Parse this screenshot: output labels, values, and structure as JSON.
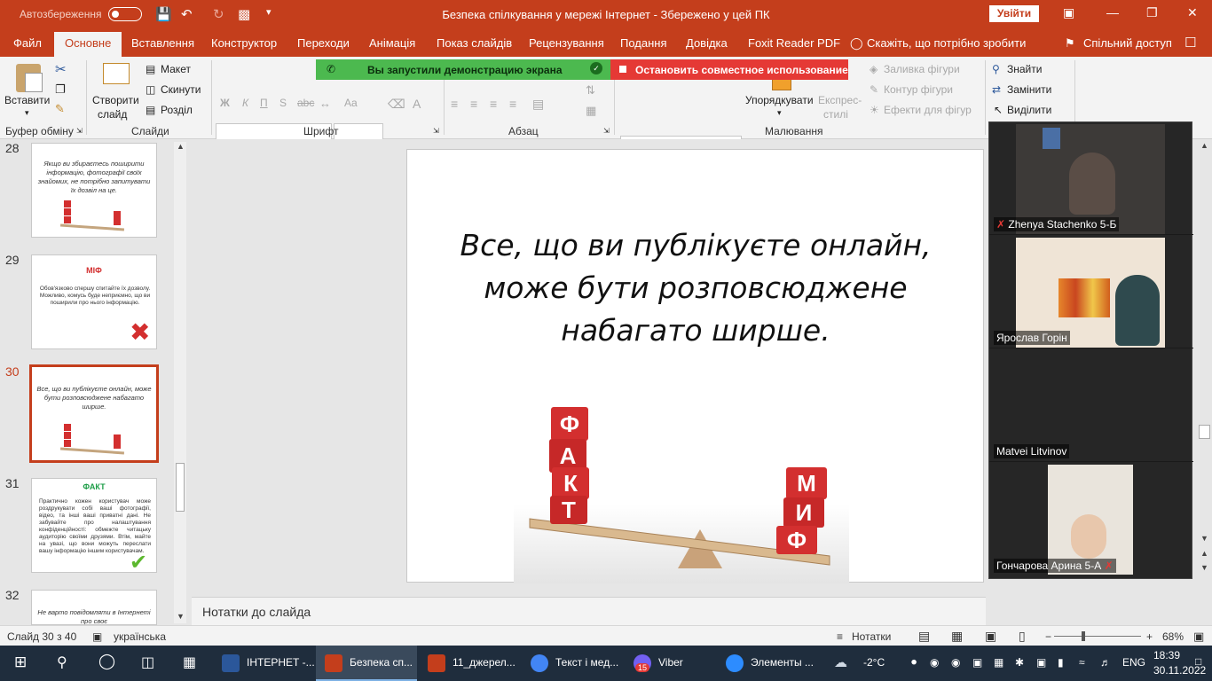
{
  "titlebar": {
    "autosave_label": "Автозбереження",
    "doc_title": "Безпека спілкування у мережі Інтернет  -  Збережено у цей ПК",
    "signin_button": "Увійти",
    "icons": [
      "save-icon",
      "undo-icon",
      "redo-icon",
      "present-icon",
      "customize-icon",
      "ribbon-display-icon",
      "minimize-icon",
      "restore-icon",
      "close-icon"
    ]
  },
  "menu": {
    "tabs": [
      "Файл",
      "Основне",
      "Вставлення",
      "Конструктор",
      "Переходи",
      "Анімація",
      "Показ слайдів",
      "Рецензування",
      "Подання",
      "Довідка",
      "Foxit Reader PDF"
    ],
    "active_tab": "Основне",
    "tell_me": "Скажіть, що потрібно зробити",
    "share": "Спільний доступ"
  },
  "ribbon": {
    "paste": "Вставити",
    "clipboard_group": "Буфер обміну",
    "new_slide_line1": "Створити",
    "new_slide_line2": "слайд",
    "layout": "Макет",
    "reset": "Скинути",
    "section": "Розділ",
    "slides_group": "Слайди",
    "font_group": "Шрифт",
    "paragraph_group": "Абзац",
    "arrange": "Упорядкувати",
    "quick_styles_line1": "Експрес-",
    "quick_styles_line2": "стилі",
    "shape_fill": "Заливка фігури",
    "shape_outline": "Контур фігури",
    "shape_effects": "Ефекти для фігур",
    "drawing_group": "Малювання",
    "find": "Знайти",
    "replace": "Замінити",
    "select": "Виділити",
    "font_buttons": [
      "Ж",
      "К",
      "П",
      "S",
      "abc",
      "Aa"
    ]
  },
  "sharing": {
    "notice": "Вы запустили демонстрацию экрана",
    "stop": "Остановить совместное использование"
  },
  "thumbnails": [
    {
      "num": "28",
      "text": "Якщо ви збираєтесь поширити інформацію, фотографії своїх знайомих, не потрібно запитувати їх дозвіл на це."
    },
    {
      "num": "29",
      "heading": "МІФ",
      "body": "Обов'язково спершу спитайте їх дозволу. Можливо, комусь буде неприємно, що ви поширили про нього інформацію.",
      "heading_color": "#d32f2f"
    },
    {
      "num": "30",
      "text": "Все, що ви публікуєте онлайн, може бути розповсюджене набагато ширше."
    },
    {
      "num": "31",
      "heading": "ФАКТ",
      "body": "Практично кожен користувач може роздрукувати собі ваші фотографії, відео, та інші ваші приватні дані. Не забувайте про налаштування конфіденційності: обмежте читацьку аудиторію своїми друзями. Втім, майте на увазі, що вони можуть переслати вашу інформацію іншим користувачам.",
      "heading_color": "#1e9e48"
    },
    {
      "num": "32",
      "text": "Не варто повідомляти в Інтернеті про своє"
    }
  ],
  "slide": {
    "text": "Все, що ви публікуєте онлайн, може бути розповсюджене набагато ширше.",
    "left_cubes": [
      "Ф",
      "А",
      "К",
      "Т"
    ],
    "right_cubes": [
      "М",
      "И",
      "Ф"
    ],
    "cube_color": "#d32f2f"
  },
  "notes_placeholder": "Нотатки до слайда",
  "participants": [
    {
      "name": "Zhenya Stachenko 5-Б",
      "muted": true
    },
    {
      "name": "Ярослав Горін"
    },
    {
      "name": "Matvei Litvinov"
    },
    {
      "name": "Гончарова Арина 5-А"
    }
  ],
  "status": {
    "slide_counter": "Слайд 30 з 40",
    "language": "українська",
    "notes": "Нотатки",
    "zoom": "68%"
  },
  "taskbar": {
    "apps": [
      {
        "label": "ІНТЕРНЕТ -...",
        "color": "#2b579a"
      },
      {
        "label": "Безпека сп...",
        "color": "#c43e1c",
        "active": true
      },
      {
        "label": "11_джерел...",
        "color": "#c43e1c"
      },
      {
        "label": "Текст і мед...",
        "color": "#4285f4"
      },
      {
        "label": "Viber",
        "color": "#7360f2",
        "badge": "15"
      },
      {
        "label": "Элементы ...",
        "color": "#2d8cff"
      }
    ],
    "weather": "-2°C",
    "lang": "ENG",
    "time": "18:39",
    "date": "30.11.2022"
  }
}
